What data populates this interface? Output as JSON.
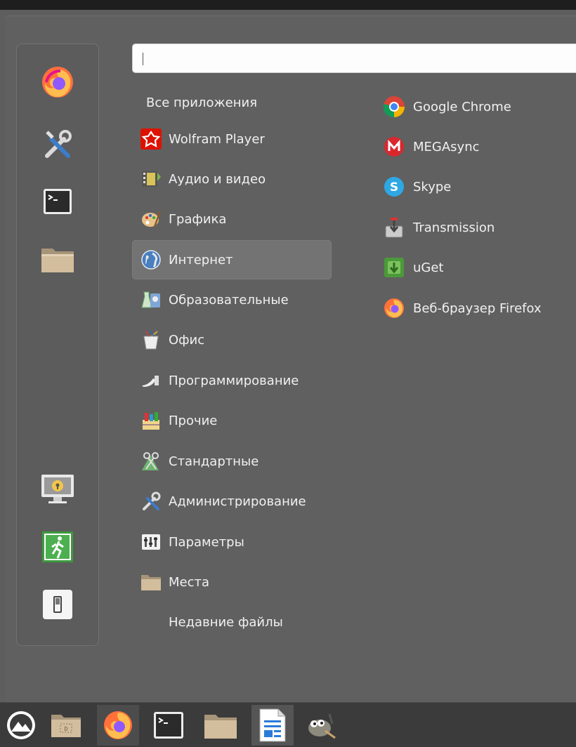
{
  "search": {
    "value": "",
    "placeholder": ""
  },
  "favorites": [
    {
      "name": "firefox",
      "icon": "firefox-icon"
    },
    {
      "name": "settings",
      "icon": "tools-icon"
    },
    {
      "name": "terminal",
      "icon": "terminal-icon"
    },
    {
      "name": "files",
      "icon": "folder-icon"
    }
  ],
  "session": [
    {
      "name": "lock-screen",
      "icon": "lock-screen-icon"
    },
    {
      "name": "logout",
      "icon": "exit-icon"
    },
    {
      "name": "shutdown",
      "icon": "power-icon"
    }
  ],
  "categories": [
    {
      "label": "Все приложения",
      "icon": ""
    },
    {
      "label": "Wolfram Player",
      "icon": "wolfram-icon"
    },
    {
      "label": "Аудио и видео",
      "icon": "film-icon"
    },
    {
      "label": "Графика",
      "icon": "palette-icon"
    },
    {
      "label": "Интернет",
      "icon": "globe-icon",
      "selected": true
    },
    {
      "label": "Образовательные",
      "icon": "education-icon"
    },
    {
      "label": "Офис",
      "icon": "office-icon"
    },
    {
      "label": "Программирование",
      "icon": "programming-icon"
    },
    {
      "label": "Прочие",
      "icon": "other-icon"
    },
    {
      "label": "Стандартные",
      "icon": "accessories-icon"
    },
    {
      "label": "Администрирование",
      "icon": "admin-icon"
    },
    {
      "label": "Параметры",
      "icon": "preferences-icon"
    },
    {
      "label": "Места",
      "icon": "folder-icon"
    },
    {
      "label": "Недавние файлы",
      "icon": ""
    }
  ],
  "apps": [
    {
      "label": "Google Chrome",
      "icon": "chrome-icon"
    },
    {
      "label": "MEGAsync",
      "icon": "mega-icon"
    },
    {
      "label": "Skype",
      "icon": "skype-icon"
    },
    {
      "label": "Transmission",
      "icon": "transmission-icon"
    },
    {
      "label": "uGet",
      "icon": "uget-icon"
    },
    {
      "label": "Веб-браузер Firefox",
      "icon": "firefox-icon"
    }
  ],
  "taskbar": [
    {
      "name": "menu",
      "icon": "cinnamon-menu-icon"
    },
    {
      "name": "show-desktop",
      "icon": "desktop-icon"
    },
    {
      "name": "firefox",
      "icon": "firefox-icon"
    },
    {
      "name": "terminal",
      "icon": "terminal-icon"
    },
    {
      "name": "files",
      "icon": "folder-icon"
    },
    {
      "name": "writer",
      "icon": "writer-icon"
    },
    {
      "name": "gimp",
      "icon": "gimp-icon"
    }
  ],
  "colors": {
    "menu_bg": "#606060",
    "selected_bg": "#737373",
    "taskbar_bg": "#3b3b3b",
    "text": "#f0f0f0"
  }
}
